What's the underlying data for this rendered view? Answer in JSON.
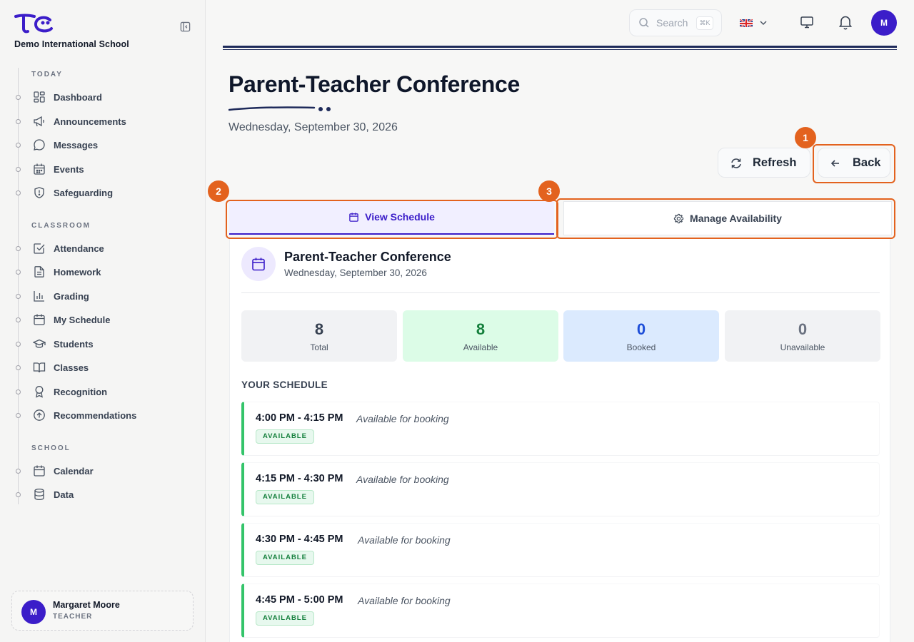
{
  "app": {
    "school_name": "Demo International School",
    "logo_text": "TC"
  },
  "sidebar": {
    "sections": [
      {
        "label": "TODAY",
        "items": [
          {
            "label": "Dashboard",
            "icon": "dashboard-icon"
          },
          {
            "label": "Announcements",
            "icon": "megaphone-icon"
          },
          {
            "label": "Messages",
            "icon": "message-icon"
          },
          {
            "label": "Events",
            "icon": "calendar-icon"
          },
          {
            "label": "Safeguarding",
            "icon": "shield-icon"
          }
        ]
      },
      {
        "label": "CLASSROOM",
        "items": [
          {
            "label": "Attendance",
            "icon": "checkbox-icon"
          },
          {
            "label": "Homework",
            "icon": "document-icon"
          },
          {
            "label": "Grading",
            "icon": "bar-chart-icon"
          },
          {
            "label": "My Schedule",
            "icon": "calendar-icon"
          },
          {
            "label": "Students",
            "icon": "graduation-cap-icon"
          },
          {
            "label": "Classes",
            "icon": "book-icon"
          },
          {
            "label": "Recognition",
            "icon": "award-icon"
          },
          {
            "label": "Recommendations",
            "icon": "arrow-up-circle-icon"
          }
        ]
      },
      {
        "label": "SCHOOL",
        "items": [
          {
            "label": "Calendar",
            "icon": "calendar-icon"
          },
          {
            "label": "Data",
            "icon": "database-icon"
          }
        ]
      }
    ],
    "user": {
      "initial": "M",
      "name": "Margaret Moore",
      "role": "TEACHER"
    }
  },
  "topbar": {
    "search_placeholder": "Search",
    "search_shortcut": "⌘K",
    "language": "English (UK)",
    "avatar_initial": "M"
  },
  "page": {
    "title": "Parent-Teacher Conference",
    "date": "Wednesday, September 30, 2026",
    "refresh_label": "Refresh",
    "back_label": "Back"
  },
  "tabs": [
    {
      "label": "View Schedule",
      "active": true
    },
    {
      "label": "Manage Availability",
      "active": false
    }
  ],
  "annotations": [
    "1",
    "2",
    "3"
  ],
  "card": {
    "title": "Parent-Teacher Conference",
    "date": "Wednesday, September 30, 2026",
    "stats": [
      {
        "value": "8",
        "label": "Total",
        "bg": "#f1f2f4",
        "color": "#374151"
      },
      {
        "value": "8",
        "label": "Available",
        "bg": "#dcfce7",
        "color": "#15803d"
      },
      {
        "value": "0",
        "label": "Booked",
        "bg": "#dbeafe",
        "color": "#1d4ed8"
      },
      {
        "value": "0",
        "label": "Unavailable",
        "bg": "#f1f2f4",
        "color": "#6b7280"
      }
    ],
    "schedule_heading": "YOUR SCHEDULE",
    "slots": [
      {
        "time": "4:00 PM - 4:15 PM",
        "note": "Available for booking",
        "status": "AVAILABLE"
      },
      {
        "time": "4:15 PM - 4:30 PM",
        "note": "Available for booking",
        "status": "AVAILABLE"
      },
      {
        "time": "4:30 PM - 4:45 PM",
        "note": "Available for booking",
        "status": "AVAILABLE"
      },
      {
        "time": "4:45 PM - 5:00 PM",
        "note": "Available for booking",
        "status": "AVAILABLE"
      }
    ]
  },
  "colors": {
    "brand": "#3b1dc9",
    "highlight": "#e3621e",
    "available": "#34c46a"
  }
}
